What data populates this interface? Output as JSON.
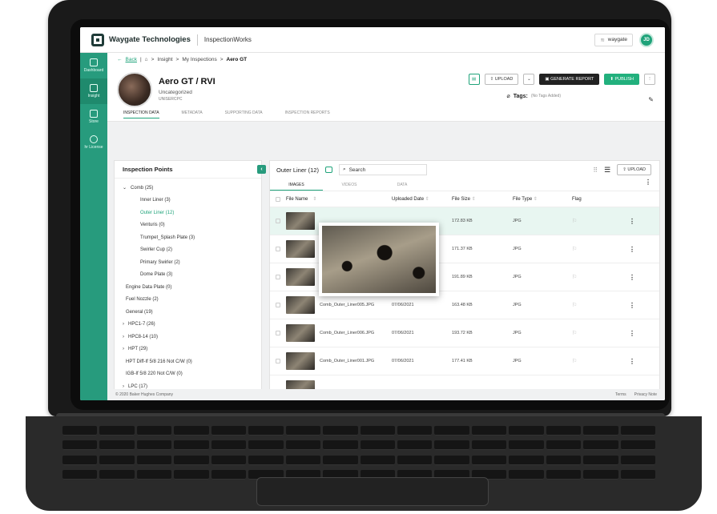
{
  "app": {
    "brand": "Waygate Technologies",
    "product": "InspectionWorks",
    "user_label": "waygate",
    "avatar_initials": "JD"
  },
  "sidebar": {
    "items": [
      {
        "label": "Dashboard",
        "icon": "dashboard-icon"
      },
      {
        "label": "Insight",
        "icon": "insight-icon"
      },
      {
        "label": "Store",
        "icon": "store-icon"
      },
      {
        "label": "hr License",
        "icon": "license-icon"
      }
    ]
  },
  "breadcrumb": {
    "back": "Back",
    "items": [
      "Insight",
      "My Inspections",
      "Aero GT"
    ]
  },
  "header": {
    "title": "Aero GT / RVI",
    "category": "Uncategorized",
    "code": "UNISERCPC",
    "tags_label": "Tags:",
    "tags_placeholder": "(No Tags Added)",
    "buttons": {
      "upload": "UPLOAD",
      "generate": "GENERATE REPORT",
      "publish": "PUBLISH"
    },
    "tabs": [
      "INSPECTION DATA",
      "METADATA",
      "SUPPORTING DATA",
      "INSPECTION REPORTS"
    ]
  },
  "inspection_points": {
    "title": "Inspection Points",
    "items": [
      {
        "label": "Comb (25)",
        "expand": "v"
      },
      {
        "label": "Inner Liner (3)"
      },
      {
        "label": "Outer Liner (12)"
      },
      {
        "label": "Venturis (0)"
      },
      {
        "label": "Trumpet_Splash Plate (3)"
      },
      {
        "label": "Swirler Cup (2)"
      },
      {
        "label": "Primary Swirler (2)"
      },
      {
        "label": "Dome Plate (3)"
      },
      {
        "label": "Engine Data Plate (0)"
      },
      {
        "label": "Fuel Nozzle (2)"
      },
      {
        "label": "General (19)"
      },
      {
        "label": "HPC1-7 (26)",
        "expand": ">"
      },
      {
        "label": "HPC8-14 (10)",
        "expand": ">"
      },
      {
        "label": "HPT (29)",
        "expand": ">"
      },
      {
        "label": "HPT Diff-If 5/8 216 Not C/W (0)"
      },
      {
        "label": "IGB-If 5/8 220 Not C/W (0)"
      },
      {
        "label": "LPC (17)",
        "expand": ">"
      }
    ]
  },
  "media": {
    "title": "Outer Liner (12)",
    "search_placeholder": "Search",
    "upload": "UPLOAD",
    "subtabs": [
      "IMAGES",
      "VIDEOS",
      "DATA"
    ],
    "columns": [
      "File Name",
      "Uploaded Date",
      "File Size",
      "File Type",
      "Flag"
    ],
    "rows": [
      {
        "name": "",
        "date": "",
        "size": "172.83 KB",
        "type": "JPG"
      },
      {
        "name": "",
        "date": "",
        "size": "171.37 KB",
        "type": "JPG"
      },
      {
        "name": "",
        "date": "",
        "size": "191.89 KB",
        "type": "JPG"
      },
      {
        "name": "Comb_Outer_Liner005.JPG",
        "date": "07/06/2021",
        "size": "163.48 KB",
        "type": "JPG"
      },
      {
        "name": "Comb_Outer_Liner006.JPG",
        "date": "07/06/2021",
        "size": "193.72 KB",
        "type": "JPG"
      },
      {
        "name": "Comb_Outer_Liner001.JPG",
        "date": "07/06/2021",
        "size": "177.41 KB",
        "type": "JPG"
      }
    ]
  },
  "footer": {
    "copyright": "© 2020 Baker Hughes Company",
    "terms": "Terms",
    "privacy": "Privacy Note"
  },
  "colors": {
    "accent": "#279b7d",
    "publish": "#22b07d"
  }
}
